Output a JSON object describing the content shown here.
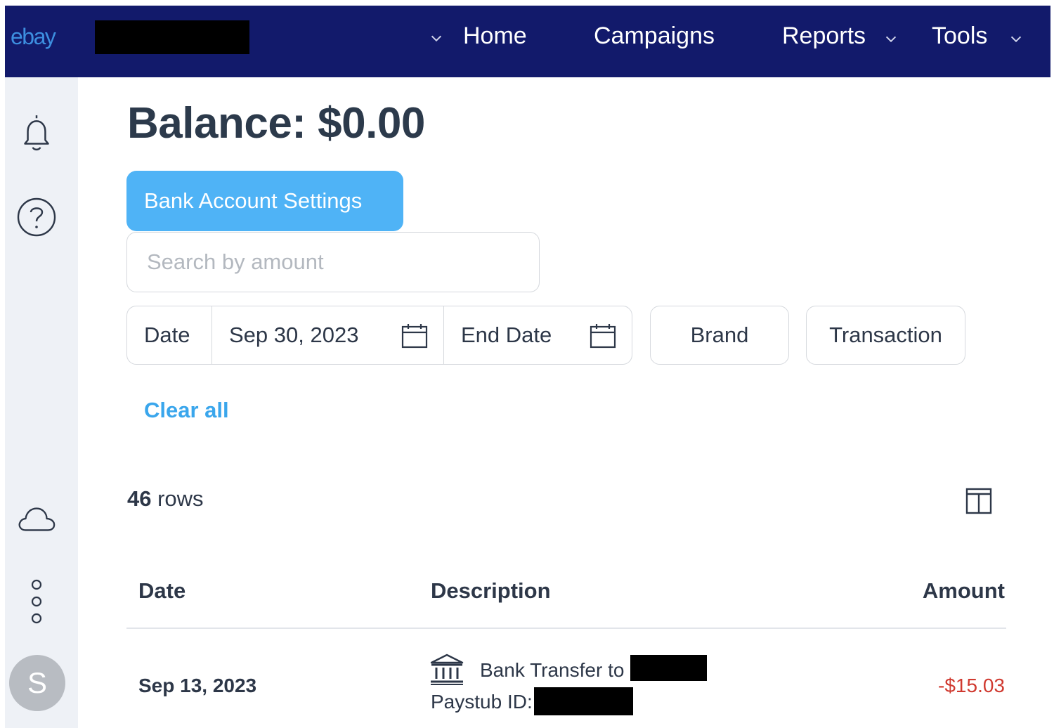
{
  "nav": {
    "logo": "ebay",
    "items": [
      {
        "label": "Home"
      },
      {
        "label": "Campaigns"
      },
      {
        "label": "Reports"
      },
      {
        "label": "Tools"
      }
    ]
  },
  "sidebar": {
    "icons": [
      "bell-icon",
      "help-icon",
      "cloud-icon",
      "more-vertical-icon"
    ],
    "avatar_initial": "S"
  },
  "main": {
    "balance": "Balance: $0.00",
    "bank_settings_label": "Bank Account Settings",
    "search_placeholder": "Search by amount",
    "filters": {
      "date_label": "Date",
      "start_date": "Sep 30, 2023",
      "end_date_placeholder": "End Date",
      "brand_label": "Brand",
      "transaction_label": "Transaction"
    },
    "clear_all": "Clear all",
    "rows_count_number": "46",
    "rows_count_suffix": " rows"
  },
  "table": {
    "headers": {
      "date": "Date",
      "description": "Description",
      "amount": "Amount"
    },
    "rows": [
      {
        "date": "Sep 13, 2023",
        "description_line1": "Bank Transfer to",
        "description_line2": "Paystub ID:",
        "amount": "-$15.03"
      }
    ]
  },
  "colors": {
    "nav_bg": "#121a6b",
    "primary_button": "#4fb3f6",
    "link": "#3aa6ec",
    "negative_amount": "#d03a30"
  }
}
